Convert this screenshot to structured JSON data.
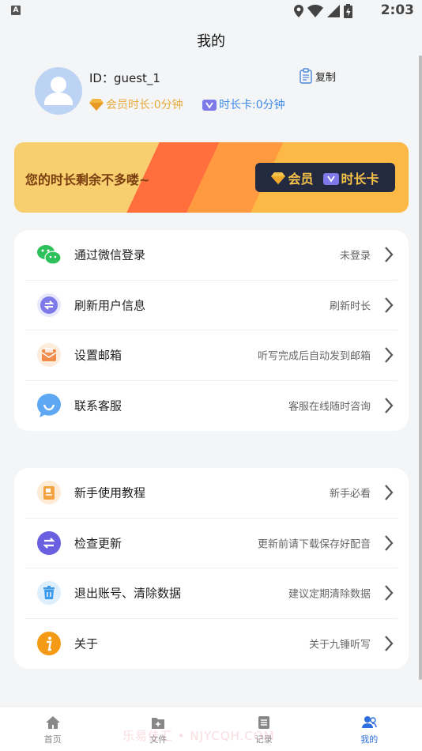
{
  "status_bar": {
    "time": "2:03"
  },
  "header": {
    "title": "我的"
  },
  "profile": {
    "id_label": "ID：guest_1",
    "copy_label": "复制",
    "member_time": "会员时长:0分钟",
    "card_time": "时长卡:0分钟"
  },
  "banner": {
    "text": "您的时长剩余不多喽~",
    "member_label": "会员",
    "card_label": "时长卡"
  },
  "menu1": [
    {
      "icon": "wechat-icon",
      "label": "通过微信登录",
      "hint": "未登录"
    },
    {
      "icon": "refresh-icon",
      "label": "刷新用户信息",
      "hint": "刷新时长"
    },
    {
      "icon": "mail-icon",
      "label": "设置邮箱",
      "hint": "听写完成后自动发到邮箱"
    },
    {
      "icon": "customer-service-icon",
      "label": "联系客服",
      "hint": "客服在线随时咨询"
    }
  ],
  "menu2": [
    {
      "icon": "tutorial-icon",
      "label": "新手使用教程",
      "hint": "新手必看"
    },
    {
      "icon": "update-icon",
      "label": "检查更新",
      "hint": "更新前请下载保存好配音"
    },
    {
      "icon": "trash-icon",
      "label": "退出账号、清除数据",
      "hint": "建议定期清除数据"
    },
    {
      "icon": "info-icon",
      "label": "关于",
      "hint": "关于九锤听写"
    }
  ],
  "nav": [
    {
      "icon": "home-icon",
      "label": "首页",
      "active": false
    },
    {
      "icon": "file-icon",
      "label": "文件",
      "active": false
    },
    {
      "icon": "record-icon",
      "label": "记录",
      "active": false
    },
    {
      "icon": "user-icon",
      "label": "我的",
      "active": true
    }
  ],
  "watermark": "乐易佳汇 • NJYCQH.COM",
  "colors": {
    "accent": "#2e6fe0",
    "gold": "#e6a93a",
    "blue": "#3f8ae6"
  }
}
